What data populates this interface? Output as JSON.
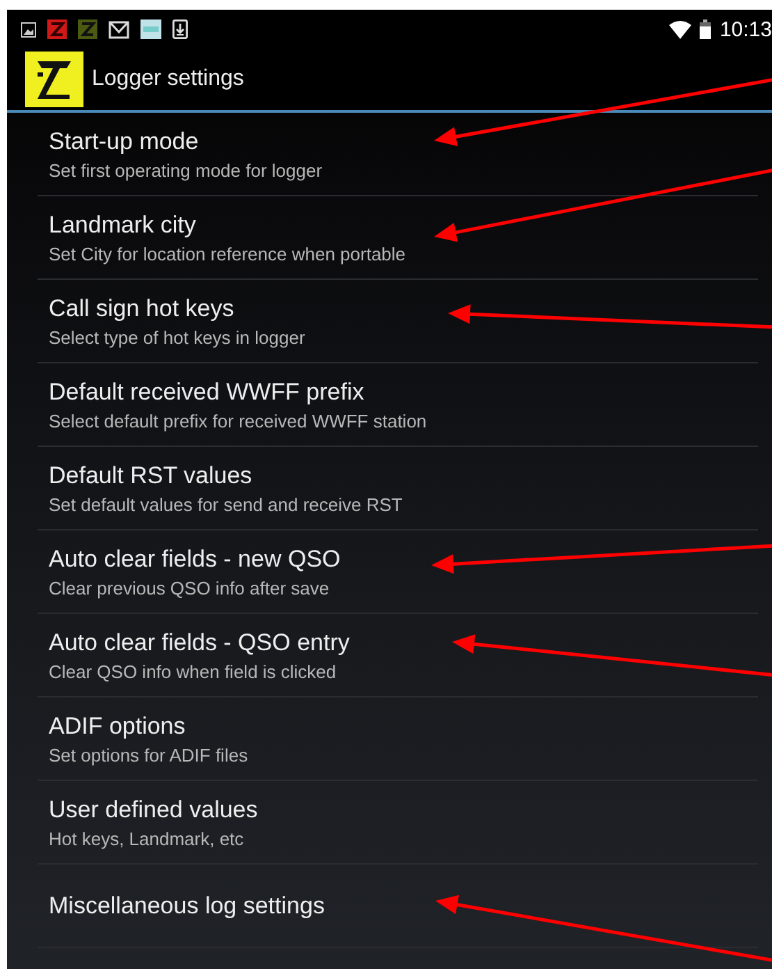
{
  "status_bar": {
    "time": "10:13"
  },
  "header": {
    "title": "Logger settings"
  },
  "items": [
    {
      "title": "Start-up mode",
      "summary": "Set first operating mode for logger",
      "arrow": true
    },
    {
      "title": "Landmark city",
      "summary": "Set City for location reference when portable",
      "arrow": true
    },
    {
      "title": "Call sign hot keys",
      "summary": "Select type of hot keys in logger",
      "arrow": true
    },
    {
      "title": "Default received WWFF prefix",
      "summary": "Select default prefix for received WWFF station",
      "arrow": false
    },
    {
      "title": "Default RST values",
      "summary": "Set default values for send and receive RST",
      "arrow": false
    },
    {
      "title": "Auto clear fields - new QSO",
      "summary": "Clear previous QSO info after save",
      "arrow": true
    },
    {
      "title": "Auto clear fields - QSO entry",
      "summary": "Clear QSO info when field is clicked",
      "arrow": true
    },
    {
      "title": "ADIF options",
      "summary": "Set options for ADIF files",
      "arrow": false
    },
    {
      "title": "User defined values",
      "summary": "Hot keys, Landmark, etc",
      "arrow": false
    },
    {
      "title": "Miscellaneous log settings",
      "arrow": true
    }
  ]
}
